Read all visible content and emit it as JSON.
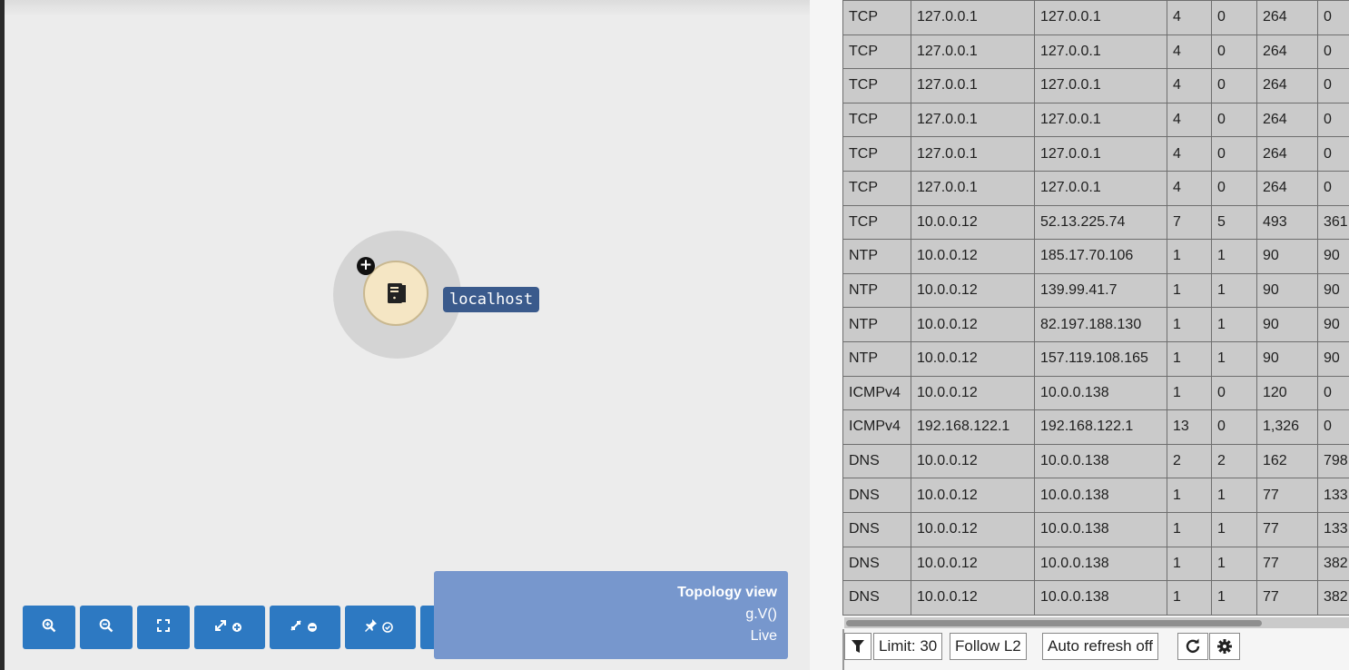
{
  "topology": {
    "node": {
      "label": "localhost",
      "icon": "server-icon"
    },
    "toolbar": [
      {
        "name": "zoom-in-button",
        "icon": "zoom-in-icon"
      },
      {
        "name": "zoom-out-button",
        "icon": "zoom-out-icon"
      },
      {
        "name": "fit-view-button",
        "icon": "fit-screen-icon"
      },
      {
        "name": "expand-all-button",
        "icon": "expand-icon"
      },
      {
        "name": "collapse-all-button",
        "icon": "collapse-icon"
      },
      {
        "name": "pin-all-button",
        "icon": "pin-check-icon"
      },
      {
        "name": "unpin-all-button",
        "icon": "pin-cancel-icon"
      }
    ],
    "view": {
      "title": "Topology view",
      "query": "g.V()",
      "mode": "Live"
    }
  },
  "flows": {
    "rows": [
      [
        "TCP",
        "127.0.0.1",
        "127.0.0.1",
        "4",
        "0",
        "264",
        "0"
      ],
      [
        "TCP",
        "127.0.0.1",
        "127.0.0.1",
        "4",
        "0",
        "264",
        "0"
      ],
      [
        "TCP",
        "127.0.0.1",
        "127.0.0.1",
        "4",
        "0",
        "264",
        "0"
      ],
      [
        "TCP",
        "127.0.0.1",
        "127.0.0.1",
        "4",
        "0",
        "264",
        "0"
      ],
      [
        "TCP",
        "127.0.0.1",
        "127.0.0.1",
        "4",
        "0",
        "264",
        "0"
      ],
      [
        "TCP",
        "127.0.0.1",
        "127.0.0.1",
        "4",
        "0",
        "264",
        "0"
      ],
      [
        "TCP",
        "10.0.0.12",
        "52.13.225.74",
        "7",
        "5",
        "493",
        "361"
      ],
      [
        "NTP",
        "10.0.0.12",
        "185.17.70.106",
        "1",
        "1",
        "90",
        "90"
      ],
      [
        "NTP",
        "10.0.0.12",
        "139.99.41.7",
        "1",
        "1",
        "90",
        "90"
      ],
      [
        "NTP",
        "10.0.0.12",
        "82.197.188.130",
        "1",
        "1",
        "90",
        "90"
      ],
      [
        "NTP",
        "10.0.0.12",
        "157.119.108.165",
        "1",
        "1",
        "90",
        "90"
      ],
      [
        "ICMPv4",
        "10.0.0.12",
        "10.0.0.138",
        "1",
        "0",
        "120",
        "0"
      ],
      [
        "ICMPv4",
        "192.168.122.1",
        "192.168.122.1",
        "13",
        "0",
        "1,326",
        "0"
      ],
      [
        "DNS",
        "10.0.0.12",
        "10.0.0.138",
        "2",
        "2",
        "162",
        "798"
      ],
      [
        "DNS",
        "10.0.0.12",
        "10.0.0.138",
        "1",
        "1",
        "77",
        "133"
      ],
      [
        "DNS",
        "10.0.0.12",
        "10.0.0.138",
        "1",
        "1",
        "77",
        "133"
      ],
      [
        "DNS",
        "10.0.0.12",
        "10.0.0.138",
        "1",
        "1",
        "77",
        "382"
      ],
      [
        "DNS",
        "10.0.0.12",
        "10.0.0.138",
        "1",
        "1",
        "77",
        "382"
      ]
    ],
    "bottom_bar": {
      "filter_icon": "filter-icon",
      "limit_label": "Limit: 30",
      "follow_label": "Follow L2",
      "auto_refresh_label": "Auto refresh off",
      "refresh_icon": "refresh-icon",
      "settings_icon": "gear-icon"
    }
  }
}
